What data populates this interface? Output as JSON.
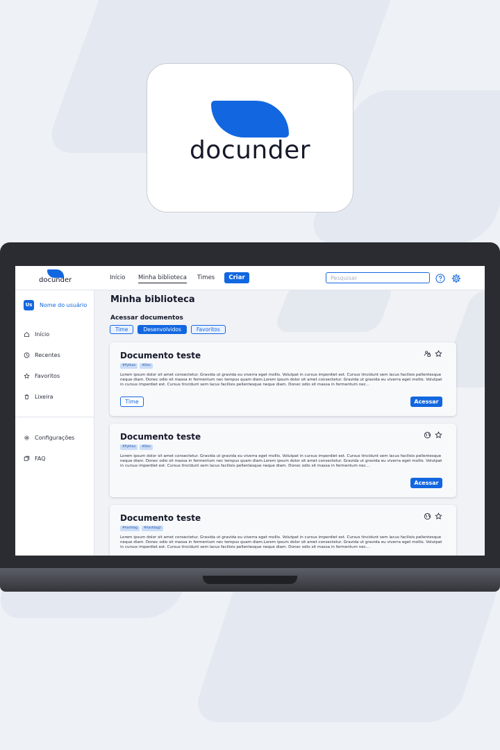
{
  "brand": {
    "name": "docunder"
  },
  "header": {
    "nav": [
      "Início",
      "Minha biblioteca",
      "Times"
    ],
    "create_label": "Criar",
    "search_placeholder": "Pesquisar"
  },
  "sidebar": {
    "avatar_initials": "Us",
    "user_name": "Nome do usuário",
    "items": [
      {
        "label": "Início",
        "icon": "home-icon"
      },
      {
        "label": "Recentes",
        "icon": "clock-icon"
      },
      {
        "label": "Favoritos",
        "icon": "star-icon"
      },
      {
        "label": "Lixeira",
        "icon": "trash-icon"
      }
    ],
    "bottom_items": [
      {
        "label": "Configurações",
        "icon": "gear-icon"
      },
      {
        "label": "FAQ",
        "icon": "faq-icon"
      }
    ]
  },
  "main": {
    "title": "Minha biblioteca",
    "section_title": "Acessar documentos",
    "filters": [
      "Time",
      "Desenvolvidos",
      "Favoritos"
    ],
    "active_filter": "Desenvolvidos",
    "documents": [
      {
        "title": "Documento teste",
        "tags": [
          "#Python",
          "#Dev"
        ],
        "description": "Lorem ipsum dolor sit amet consectetur. Gravida ut gravida eu viverra eget mollis. Volutpat in cursus imperdiet est. Cursus tincidunt sem lacus facilisis pellentesque neque diam. Donec odio sit massa in fermentum nec tempus quam diam.Lorem ipsum dolor sit amet consectetur. Gravida ut gravida eu viverra eget mollis. Volutpat in cursus imperdiet est. Cursus tincidunt sem lacus facilisis pellentesque neque diam. Donec odio sit massa in fermentum nec...",
        "visibility_icon": "team-lock-icon",
        "team_label": "Time",
        "access_label": "Acessar"
      },
      {
        "title": "Documento teste",
        "tags": [
          "#Python",
          "#Dev"
        ],
        "description": "Lorem ipsum dolor sit amet consectetur. Gravida ut gravida eu viverra eget mollis. Volutpat in cursus imperdiet est. Cursus tincidunt sem lacus facilisis pellentesque neque diam. Donec odio sit massa in fermentum nec tempus quam diam.Lorem ipsum dolor sit amet consectetur. Gravida ut gravida eu viverra eget mollis. Volutpat in cursus imperdiet est. Cursus tincidunt sem lacus facilisis pellentesque neque diam. Donec odio sit massa in fermentum nec...",
        "visibility_icon": "globe-icon",
        "access_label": "Acessar"
      },
      {
        "title": "Documento teste",
        "tags": [
          "#hashtag",
          "#hashtag2"
        ],
        "description": "Lorem ipsum dolor sit amet consectetur. Gravida ut gravida eu viverra eget mollis. Volutpat in cursus imperdiet est. Cursus tincidunt sem lacus facilisis pellentesque neque diam. Donec odio sit massa in fermentum nec tempus quam diam.Lorem ipsum dolor sit amet consectetur. Gravida ut gravida eu viverra eget mollis. Volutpat in cursus imperdiet est. Cursus tincidunt sem lacus facilisis pellentesque neque diam. Donec odio sit massa in fermentum nec...",
        "visibility_icon": "globe-icon"
      }
    ]
  },
  "colors": {
    "accent": "#1267e0",
    "background": "#eef1f6",
    "text": "#15192a"
  }
}
